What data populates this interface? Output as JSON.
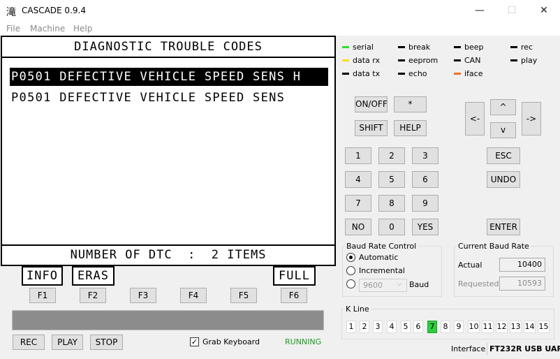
{
  "window": {
    "icon_glyph": "滝",
    "title": "CASCADE 0.9.4",
    "minimize_glyph": "—",
    "maximize_glyph": "☐",
    "close_glyph": "✕"
  },
  "menu": [
    "File",
    "Machine",
    "Help"
  ],
  "lcd": {
    "header": "DIAGNOSTIC TROUBLE CODES",
    "lines": [
      "P0501 DEFECTIVE VEHICLE SPEED SENS H",
      "P0501 DEFECTIVE VEHICLE SPEED SENS"
    ],
    "footer": "NUMBER OF DTC  :  2 ITEMS",
    "soft_labels": {
      "f1": "INFO",
      "f2": "ERAS",
      "f6": "FULL"
    }
  },
  "function_keys": [
    "F1",
    "F2",
    "F3",
    "F4",
    "F5",
    "F6"
  ],
  "controls": {
    "rec": "REC",
    "play": "PLAY",
    "stop": "STOP",
    "grab_keyboard": "Grab Keyboard",
    "grab_keyboard_checked": true,
    "status": "RUNNING",
    "status_color": "#1e9a1e"
  },
  "leds": [
    {
      "label": "serial",
      "color": "#2ee02e"
    },
    {
      "label": "break",
      "color": "#000000"
    },
    {
      "label": "beep",
      "color": "#000000"
    },
    {
      "label": "rec",
      "color": "#000000"
    },
    {
      "label": "data rx",
      "color": "#f5e11c"
    },
    {
      "label": "eeprom",
      "color": "#000000"
    },
    {
      "label": "CAN",
      "color": "#000000"
    },
    {
      "label": "play",
      "color": "#000000"
    },
    {
      "label": "data tx",
      "color": "#000000"
    },
    {
      "label": "echo",
      "color": "#000000"
    },
    {
      "label": "iface",
      "color": "#f07020"
    }
  ],
  "keypad": {
    "on_off": "ON/OFF",
    "star": "*",
    "shift": "SHIFT",
    "help": "HELP",
    "k1": "1",
    "k2": "2",
    "k3": "3",
    "k4": "4",
    "k5": "5",
    "k6": "6",
    "k7": "7",
    "k8": "8",
    "k9": "9",
    "no": "NO",
    "k0": "0",
    "yes": "YES",
    "left": "<-",
    "up": "^",
    "down": "v",
    "right": "->",
    "esc": "ESC",
    "undo": "UNDO",
    "enter": "ENTER"
  },
  "baud_control": {
    "title": "Baud Rate Control",
    "automatic": "Automatic",
    "incremental": "Incremental",
    "selected": "automatic",
    "manual_value": "9600",
    "baud_label": "Baud"
  },
  "current_baud": {
    "title": "Current Baud Rate",
    "actual_label": "Actual",
    "actual_value": "10400",
    "requested_label": "Requested",
    "requested_value": "10593"
  },
  "k_line": {
    "title": "K Line",
    "cells": [
      "1",
      "2",
      "3",
      "4",
      "5",
      "6",
      "7",
      "8",
      "9",
      "10",
      "11",
      "12",
      "13",
      "14",
      "15"
    ],
    "active": "7",
    "active_color": "#2ecc40"
  },
  "statusbar": {
    "interface_label": "Interface",
    "interface_value": "FT232R USB UAR"
  }
}
